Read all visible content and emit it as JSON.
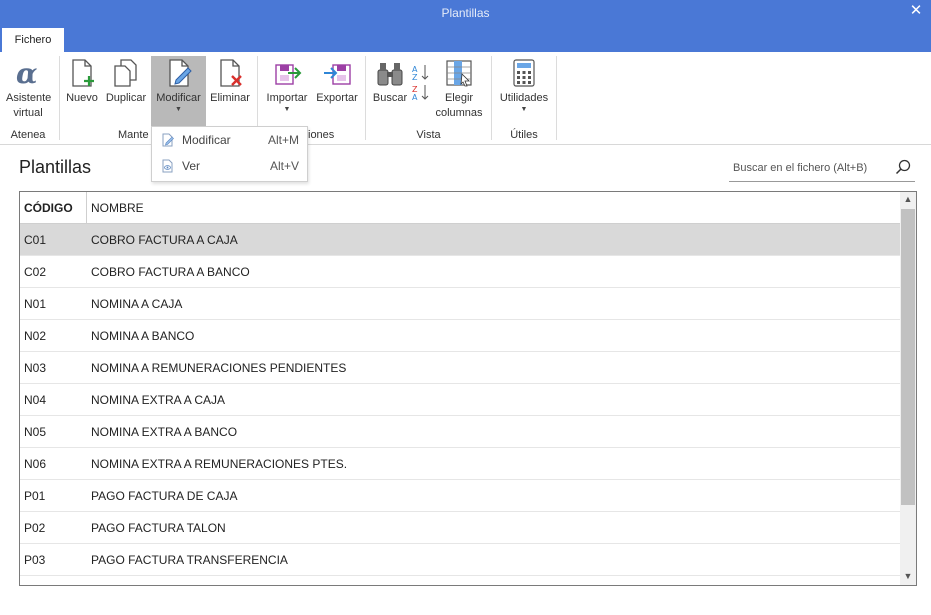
{
  "window": {
    "title": "Plantillas"
  },
  "tabs": [
    {
      "label": "Fichero"
    }
  ],
  "ribbon": {
    "buttons": {
      "asistente": "Asistente virtual",
      "nuevo": "Nuevo",
      "duplicar": "Duplicar",
      "modificar": "Modificar",
      "eliminar": "Eliminar",
      "importar": "Importar",
      "exportar": "Exportar",
      "buscar": "Buscar",
      "elegir": "Elegir columnas",
      "utilidades": "Utilidades"
    },
    "groups": {
      "atenea": "Atenea",
      "mantenimiento": "Mante",
      "acciones": "iones",
      "vista": "Vista",
      "utiles": "Útiles"
    }
  },
  "dropdown": {
    "items": [
      {
        "label": "Modificar",
        "shortcut": "Alt+M",
        "icon": "edit-document-icon"
      },
      {
        "label": "Ver",
        "shortcut": "Alt+V",
        "icon": "view-document-icon"
      }
    ]
  },
  "main": {
    "title": "Plantillas",
    "search": {
      "placeholder": "Buscar en el fichero (Alt+B)",
      "value": ""
    },
    "table": {
      "columns": [
        "CÓDIGO",
        "NOMBRE"
      ],
      "rows": [
        [
          "C01",
          "COBRO FACTURA A CAJA"
        ],
        [
          "C02",
          "COBRO FACTURA A BANCO"
        ],
        [
          "N01",
          "NOMINA A CAJA"
        ],
        [
          "N02",
          "NOMINA A BANCO"
        ],
        [
          "N03",
          "NOMINA A REMUNERACIONES PENDIENTES"
        ],
        [
          "N04",
          "NOMINA EXTRA A CAJA"
        ],
        [
          "N05",
          "NOMINA EXTRA A BANCO"
        ],
        [
          "N06",
          "NOMINA EXTRA A REMUNERACIONES PTES."
        ],
        [
          "P01",
          "PAGO FACTURA DE CAJA"
        ],
        [
          "P02",
          "PAGO FACTURA TALON"
        ],
        [
          "P03",
          "PAGO FACTURA TRANSFERENCIA"
        ]
      ],
      "selected_row": 0
    }
  },
  "colors": {
    "accent": "#4a78d6",
    "selected_row": "#d9d9d9"
  }
}
